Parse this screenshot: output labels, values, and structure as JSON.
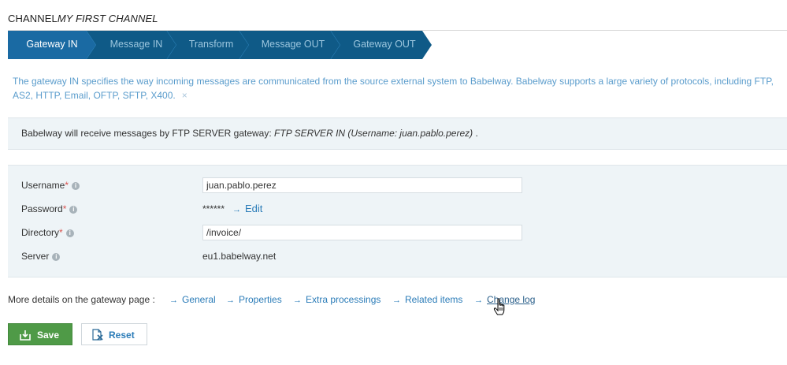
{
  "header": {
    "prefix": "CHANNEL",
    "channel_name": "MY FIRST CHANNEL"
  },
  "steps": [
    {
      "label": "Gateway IN",
      "active": true
    },
    {
      "label": "Message IN",
      "active": false
    },
    {
      "label": "Transform",
      "active": false
    },
    {
      "label": "Message OUT",
      "active": false
    },
    {
      "label": "Gateway OUT",
      "active": false
    }
  ],
  "info": {
    "text": "The gateway IN specifies the way incoming messages are communicated from the source external system to Babelway. Babelway supports a large variety of protocols, including FTP, AS2, HTTP, Email, OFTP, SFTP, X400.",
    "close_icon": "×"
  },
  "receive": {
    "text": "Babelway will receive messages by FTP SERVER gateway:",
    "gateway": "FTP SERVER IN (Username: juan.pablo.perez)",
    "suffix": "."
  },
  "form": {
    "username_label": "Username",
    "username_value": "juan.pablo.perez",
    "password_label": "Password",
    "password_value": "******",
    "edit_label": "Edit",
    "directory_label": "Directory",
    "directory_value": "/invoice/",
    "server_label": "Server",
    "server_value": "eu1.babelway.net",
    "required_mark": "*"
  },
  "details": {
    "label": "More details on the gateway page :",
    "links": [
      "General",
      "Properties",
      "Extra processings",
      "Related items",
      "Change log"
    ]
  },
  "buttons": {
    "save": "Save",
    "reset": "Reset"
  },
  "icons": {
    "arrow": "→",
    "info": "i"
  },
  "colors": {
    "step_active": "#1a6aa3",
    "step_inactive": "#0f5a87",
    "link": "#2b7cb8",
    "save_green": "#4f9a47"
  }
}
